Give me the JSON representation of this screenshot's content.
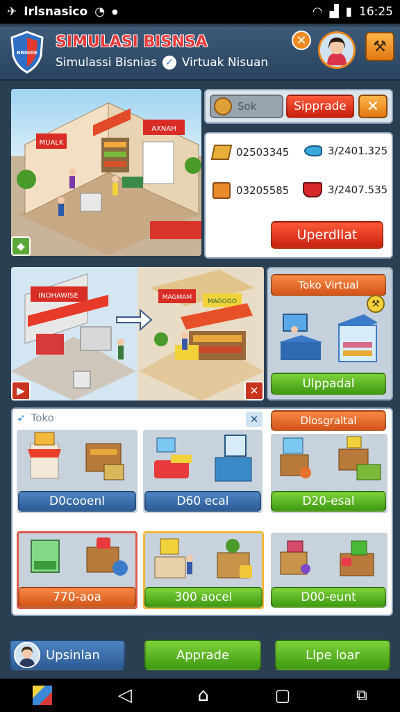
{
  "status": {
    "app_name": "Irlsnasico",
    "time": "16:25"
  },
  "header": {
    "title": "SIMULASI BISNSA",
    "subtitle": "Simulassi Bisnias",
    "verified_label": "Virtuak Nisuan",
    "shield_text": "BRIGDE"
  },
  "top_panel": {
    "coin_label": "Sok",
    "upgrade_label": "Sipprade",
    "stats": [
      {
        "icon": "crate-icon",
        "value": "02503345"
      },
      {
        "icon": "fish-icon",
        "value": "3/2401.325"
      },
      {
        "icon": "box-icon",
        "value": "03205585"
      },
      {
        "icon": "cart-icon",
        "value": "3/2407.535"
      }
    ],
    "update_button": "Uperdllat"
  },
  "scene_signs": {
    "shop1": "MUALK",
    "shop2": "AXNAH",
    "shop3": "INOHAWISE",
    "shop4": "MAGMAM",
    "shop5": "MAGOGO"
  },
  "virtual_shop": {
    "tag": "Toko Virtual",
    "button": "Ulppadal"
  },
  "toko": {
    "label": "Toko",
    "tag": "Dlosgraltal",
    "items": [
      {
        "label": "D0cooenl",
        "color": "blue"
      },
      {
        "label": "D60 ecal",
        "color": "blue"
      },
      {
        "label": "D20-esal",
        "color": "green"
      },
      {
        "label": "770-aoa",
        "color": "orange"
      },
      {
        "label": "300 aocel",
        "color": "green"
      },
      {
        "label": "D00-eunt",
        "color": "green"
      }
    ]
  },
  "bottom": {
    "profile_label": "Upsinlan",
    "upgrade_label": "Apprade",
    "third_label": "Llpe loar"
  },
  "colors": {
    "accent_red": "#d83018",
    "accent_green": "#4aa81e",
    "accent_blue": "#3a6ea8",
    "accent_orange": "#e8702a"
  }
}
